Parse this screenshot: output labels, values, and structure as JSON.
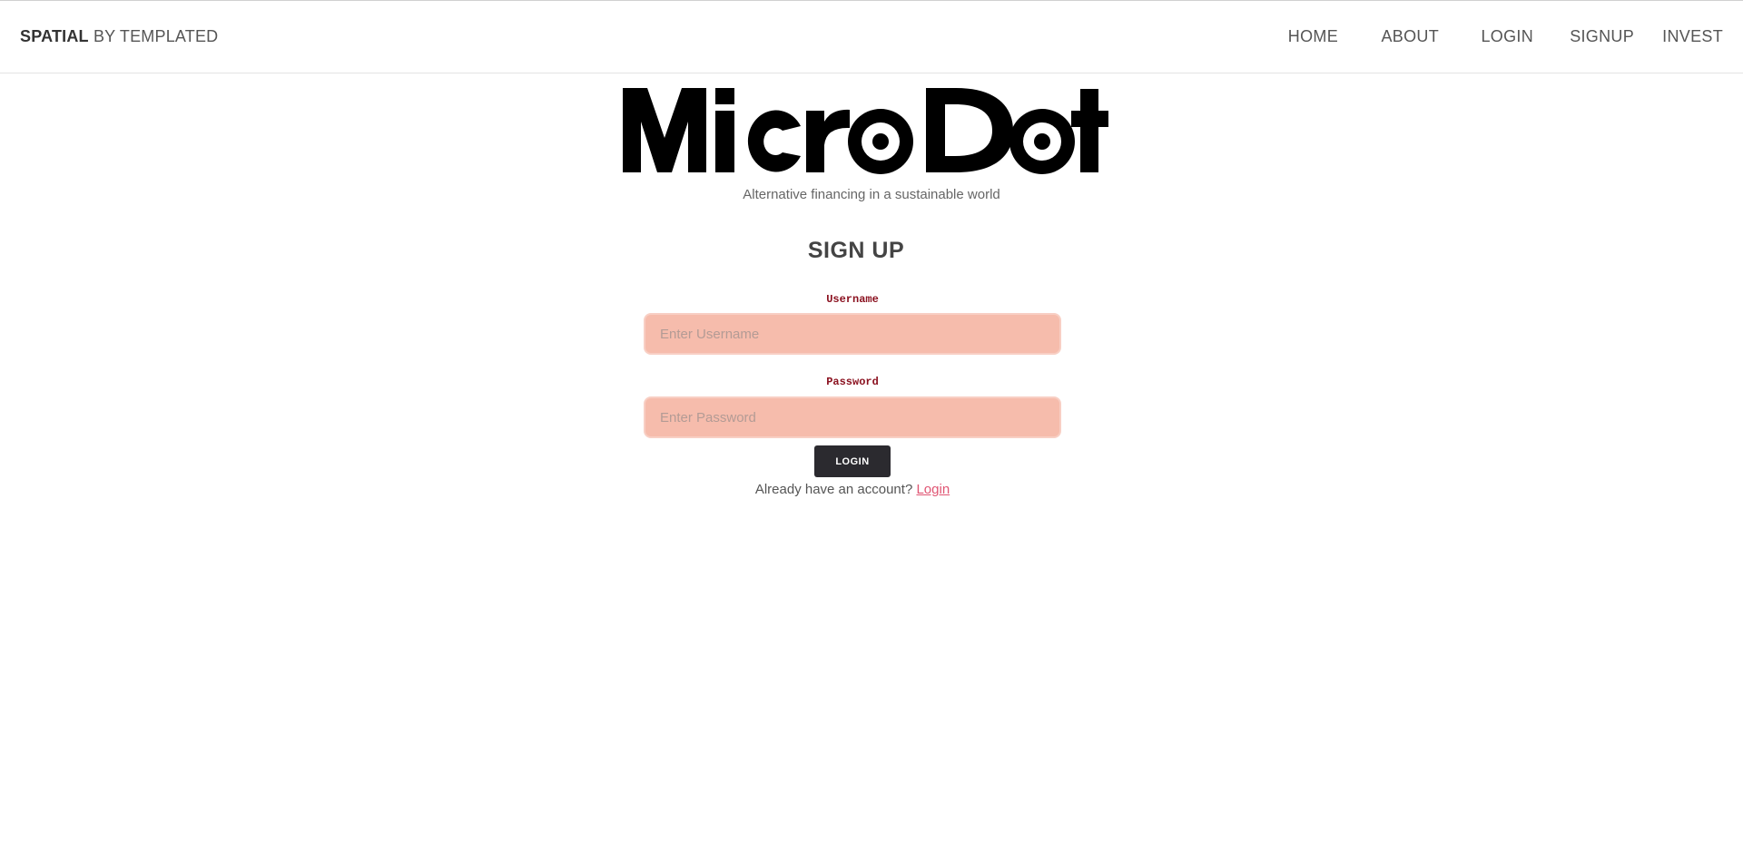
{
  "header": {
    "brand_strong": "SPATIAL",
    "brand_light": "BY TEMPLATED",
    "nav": [
      {
        "label": "HOME"
      },
      {
        "label": "ABOUT"
      },
      {
        "label": "LOGIN"
      },
      {
        "label": "SIGNUP"
      },
      {
        "label": "INVEST"
      }
    ]
  },
  "hero": {
    "logo_text": "MicroDot",
    "tagline": "Alternative financing in a sustainable world"
  },
  "form": {
    "title": "SIGN UP",
    "username_label": "Username",
    "username_placeholder": "Enter Username",
    "username_value": "",
    "password_label": "Password",
    "password_placeholder": "Enter Password",
    "password_value": "",
    "submit_label": "LOGIN",
    "already_text": "Already have an account?",
    "login_link": "Login"
  },
  "colors": {
    "input_bg": "#f6bcac",
    "label_color": "#8b1220",
    "button_bg": "#2b2a2f",
    "link_color": "#e05573"
  }
}
